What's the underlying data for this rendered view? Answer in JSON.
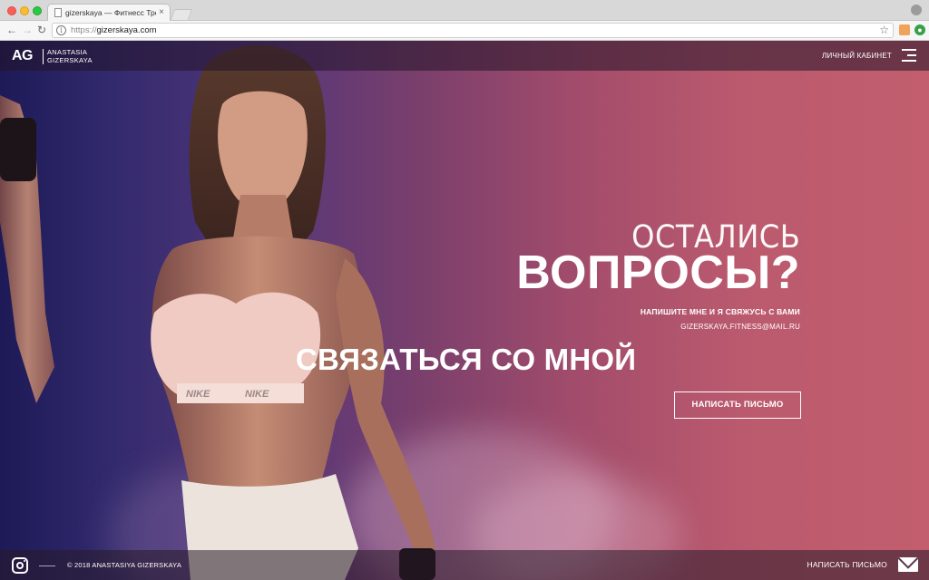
{
  "browser": {
    "tab_title": "gizerskaya — Фитнесс Трене",
    "tab_close": "×",
    "url_scheme": "https://",
    "url_host": "gizerskaya.com",
    "back": "←",
    "forward": "→",
    "reload": "↻",
    "star": "☆",
    "info": "i"
  },
  "header": {
    "logo_mark": "AG",
    "logo_name_line1": "ANASTASIA",
    "logo_name_line2": "GIZERSKAYA",
    "cabinet_label": "ЛИЧНЫЙ КАБИНЕТ"
  },
  "hero": {
    "heading_light": "ОСТАЛИСЬ",
    "heading_bold": "ВОПРОСЫ?",
    "subtitle": "НАПИШИТЕ МНЕ И Я СВЯЖУСЬ С ВАМИ",
    "email": "GIZERSKAYA.FITNESS@MAIL.RU",
    "contact_heading": "СВЯЗАТЬСЯ СО МНОЙ",
    "button_label": "НАПИСАТЬ ПИСЬМО"
  },
  "footer": {
    "copyright": "© 2018 ANASTASIYA GIZERSKAYA",
    "write_label": "НАПИСАТЬ ПИСЬМО"
  },
  "colors": {
    "gradient_left": "#1d1a57",
    "gradient_right": "#c25e6e",
    "text": "#ffffff"
  },
  "icons": [
    "document-icon",
    "info-icon",
    "star-icon",
    "menu-icon",
    "instagram-icon",
    "mail-icon"
  ]
}
